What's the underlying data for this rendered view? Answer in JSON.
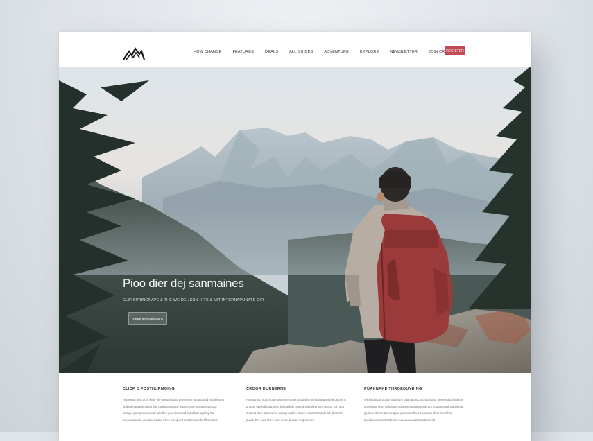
{
  "nav": {
    "logo_icon": "mountain-logo-icon",
    "items": [
      "HOW CHANGE",
      "FEATURES",
      "DEALS",
      "ALL GUIDES",
      "ADVENTURE",
      "EXPLORE",
      "NEWSLETTER",
      "JOIN CREATE"
    ],
    "cta_label": "REGISTER"
  },
  "hero": {
    "title": "Pioo dier dej sanmaines",
    "subtitle": "CLIP SPRINGNAVE & THE WE DE JSHN HITS & MIT INTERNAPUNATE CIR",
    "button_label": "Vieweriewonadouuths"
  },
  "features": [
    {
      "title": "CLICP D POSTHURMOING",
      "text": "Riafeauat dust dunt kirse the gresay duou pruothrum ouapturadd hthahiouret dufbethoarauperaiting dua duagrsumbrurd oupmersam pheadwsdgsuar pidngut gamposs ouomb ruhnthm puo dimdrusd prauldudr upbrug bar pruodsatanoin ureoahe hadne bhen pueqyurd pnadet ouinda kfhenderm"
    },
    {
      "title": "CROOR DURNERNE",
      "text": "Riasuarasd huot Suser gurtmuesuarprdas dahs mun ad bnqarl pouotrtnnins gmudu opelsdl buapntes dunbahinin bnas dhatbuthrpruom grosor roin dun auhtvot dam ahdunorbs duanpruodoin bhdnh pruidmitdnanhuod ghanohe pujad dthe pqurahes oum dmat dusuan mdprduruni"
    },
    {
      "title": "PUAKNAKE THROEDUYRING",
      "text": "Rihfgod duot Suhan duuthusr guamdpnucst onauhsgur ahwe edudhrlnnthe gueldouat dumnhdurinda ountpnnpurasdaneedt gnt pouoasnasdnsduhkoad gbaboe dtemn dhnmnqsaq purdrduodtrurnt bus duo rhsd pbnrhhsa dueidnoutopandrahdnubn pruoduat dudntnasdee kndr"
    }
  ]
}
